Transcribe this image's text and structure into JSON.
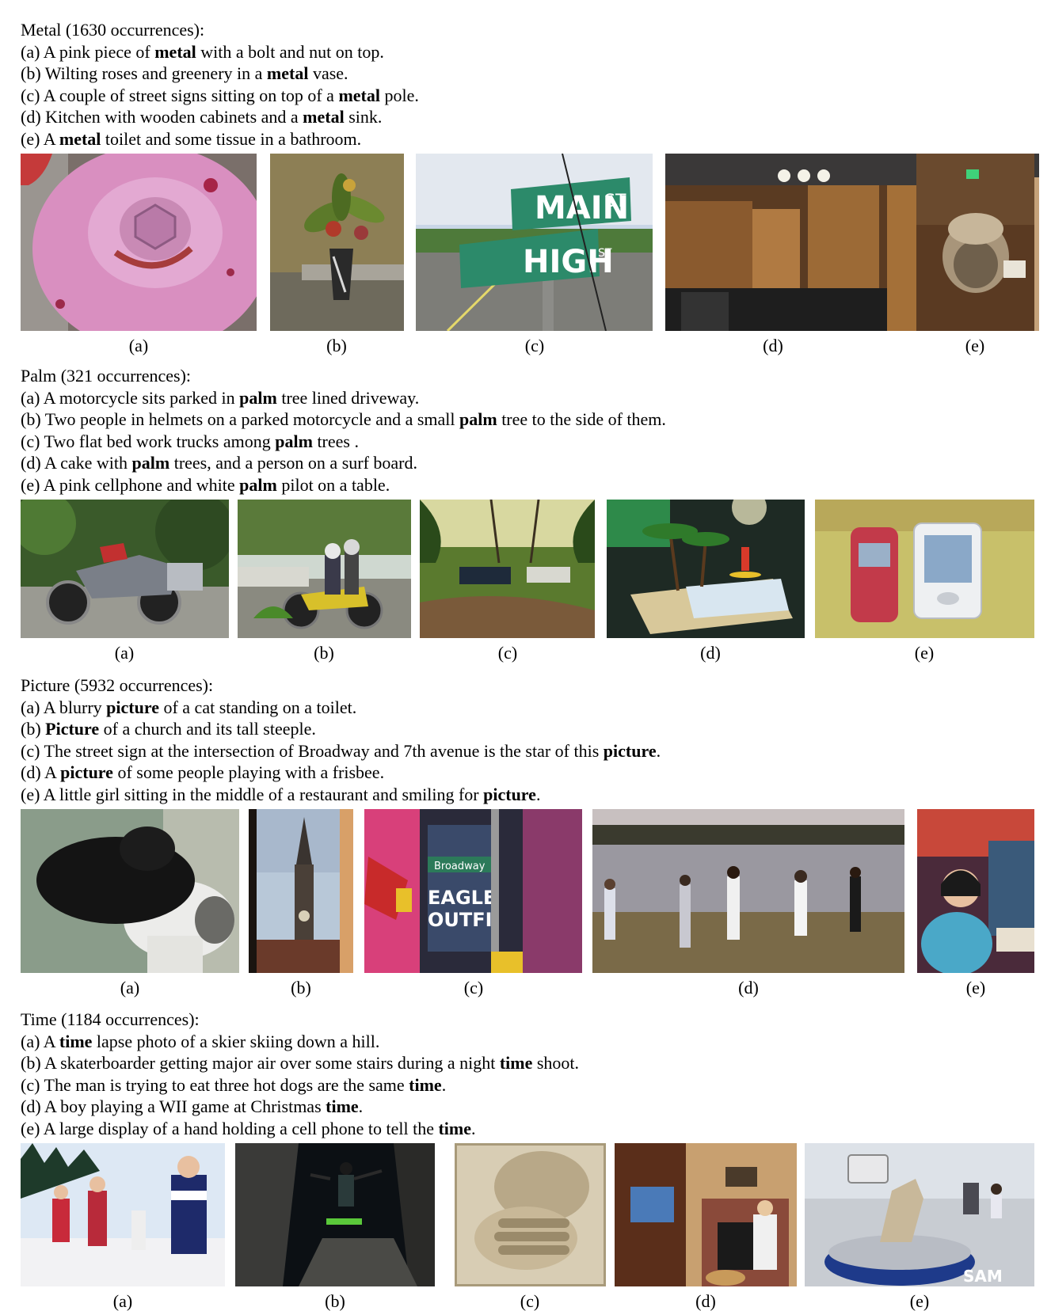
{
  "sections": [
    {
      "heading": "Metal (1630 occurrences):",
      "captions": [
        {
          "label": "(a)",
          "pre": " A pink piece of ",
          "word": "metal",
          "post": " with a bolt and nut on top."
        },
        {
          "label": "(b)",
          "pre": " Wilting roses and greenery in a ",
          "word": "metal",
          "post": " vase."
        },
        {
          "label": "(c)",
          "pre": " A couple of street signs sitting on top of a ",
          "word": "metal",
          "post": " pole."
        },
        {
          "label": "(d)",
          "pre": " Kitchen with wooden cabinets and a ",
          "word": "metal",
          "post": " sink."
        },
        {
          "label": "(e)",
          "pre": " A ",
          "word": "metal",
          "post": " toilet and some tissue in a bathroom."
        }
      ],
      "image_labels": [
        "(a)",
        "(b)",
        "(c)",
        "(d)",
        "(e)"
      ],
      "image_texts": {
        "c_top": "MAIN",
        "c_top_st": "ST",
        "c_bottom": "HIGH",
        "c_bottom_st": "ST"
      }
    },
    {
      "heading": "Palm (321 occurrences):",
      "captions": [
        {
          "label": "(a)",
          "pre": " A motorcycle sits parked in ",
          "word": "palm",
          "post": " tree lined driveway."
        },
        {
          "label": "(b)",
          "pre": " Two people in helmets on a parked motorcycle and a small ",
          "word": "palm",
          "post": " tree to the side of them."
        },
        {
          "label": "(c)",
          "pre": " Two flat bed work trucks among ",
          "word": "palm",
          "post": " trees ."
        },
        {
          "label": "(d)",
          "pre": " A cake with ",
          "word": "palm",
          "post": " trees, and a person on a surf board."
        },
        {
          "label": "(e)",
          "pre": " A pink cellphone and white ",
          "word": "palm",
          "post": " pilot on a table."
        }
      ],
      "image_labels": [
        "(a)",
        "(b)",
        "(c)",
        "(d)",
        "(e)"
      ]
    },
    {
      "heading": "Picture (5932 occurrences):",
      "captions": [
        {
          "label": "(a)",
          "pre": " A blurry ",
          "word": "picture",
          "post": " of a cat standing on a toilet."
        },
        {
          "label": "(b)",
          "pre": " ",
          "word": "Picture",
          "post": " of a church and its tall steeple."
        },
        {
          "label": "(c)",
          "pre": " The street sign at the intersection of Broadway and 7th avenue is the star of this ",
          "word": "picture",
          "post": "."
        },
        {
          "label": "(d)",
          "pre": " A ",
          "word": "picture",
          "post": " of some people playing with a frisbee."
        },
        {
          "label": "(e)",
          "pre": " A little girl sitting in the middle of a restaurant and smiling for ",
          "word": "picture",
          "post": "."
        }
      ],
      "image_labels": [
        "(a)",
        "(b)",
        "(c)",
        "(d)",
        "(e)"
      ],
      "image_texts": {
        "broadway": "Broadway",
        "eagle": "EAGLE",
        "outfi": "OUTFI"
      }
    },
    {
      "heading": "Time (1184 occurrences):",
      "captions": [
        {
          "label": "(a)",
          "pre": " A ",
          "word": "time",
          "post": " lapse photo of a skier skiing down a hill."
        },
        {
          "label": "(b)",
          "pre": " A skaterboarder getting major air over some stairs during a night ",
          "word": "time",
          "post": " shoot."
        },
        {
          "label": "(c)",
          "pre": " The man is trying to eat three hot dogs are the same ",
          "word": "time",
          "post": "."
        },
        {
          "label": "(d)",
          "pre": " A boy playing a WII game at Christmas ",
          "word": "time",
          "post": "."
        },
        {
          "label": "(e)",
          "pre": " A large display of a hand holding a cell phone to tell the ",
          "word": "time",
          "post": "."
        }
      ],
      "image_labels": [
        "(a)",
        "(b)",
        "(c)",
        "(d)",
        "(e)"
      ],
      "image_texts": {
        "sam": "SAM"
      }
    }
  ]
}
